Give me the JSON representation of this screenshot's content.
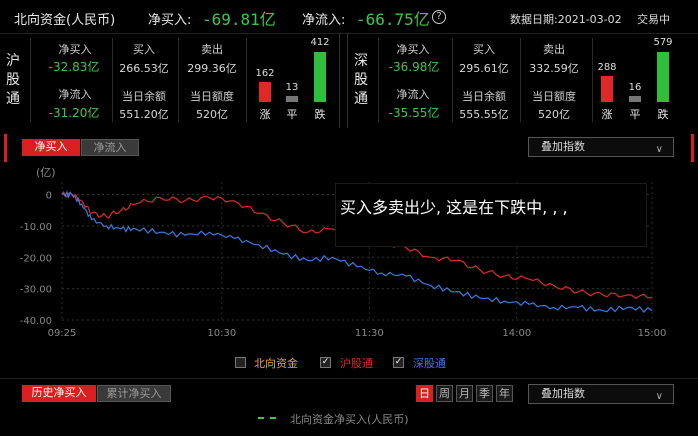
{
  "header": {
    "title": "北向资金(人民币)",
    "net_buy_label": "净买入:",
    "net_buy_value": "-69.81亿",
    "net_inflow_label": "净流入:",
    "net_inflow_value": "-66.75亿",
    "help_icon": "?",
    "date_text": "数据日期:2021-03-02",
    "status": "交易中"
  },
  "sh": {
    "name": "沪股通",
    "net_buy_label": "净买入",
    "net_buy_value": "-32.83亿",
    "net_inflow_label": "净流入",
    "net_inflow_value": "-31.20亿",
    "buy_label": "买入",
    "buy_value": "266.53亿",
    "sell_label": "卖出",
    "sell_value": "299.36亿",
    "balance_label": "当日余额",
    "balance_value": "551.20亿",
    "quota_label": "当日额度",
    "quota_value": "520亿",
    "up": "162",
    "flat": "13",
    "down": "412",
    "up_label": "涨",
    "flat_label": "平",
    "down_label": "跌"
  },
  "sz": {
    "name": "深股通",
    "net_buy_label": "净买入",
    "net_buy_value": "-36.98亿",
    "net_inflow_label": "净流入",
    "net_inflow_value": "-35.55亿",
    "buy_label": "买入",
    "buy_value": "295.61亿",
    "sell_label": "卖出",
    "sell_value": "332.59亿",
    "balance_label": "当日余额",
    "balance_value": "555.55亿",
    "quota_label": "当日额度",
    "quota_value": "520亿",
    "up": "288",
    "flat": "16",
    "down": "579",
    "up_label": "涨",
    "flat_label": "平",
    "down_label": "跌"
  },
  "chart_tabs": {
    "net_buy": "净买入",
    "net_inflow": "净流入"
  },
  "overlay_dropdown": "叠加指数",
  "annotation": "买入多卖出少, 这是在下跌中, , ,",
  "chart_data": {
    "type": "line",
    "ylabel": "(亿)",
    "yticks": [
      "0",
      "-10.00",
      "-20.00",
      "-30.00",
      "-40.00"
    ],
    "xticks": [
      "09:25",
      "10:30",
      "11:30",
      "14:00",
      "15:00"
    ],
    "ylim": [
      -40,
      4
    ],
    "series": [
      {
        "name": "沪股通",
        "color": "#e02828",
        "x": [
          0,
          4,
          8,
          12,
          18,
          24,
          30,
          40,
          50,
          60,
          70,
          80,
          90,
          100,
          110,
          120,
          130,
          140,
          150,
          160,
          170,
          180,
          190,
          200,
          210,
          220,
          230,
          240
        ],
        "values": [
          0,
          0,
          -2,
          -6,
          -7,
          -5,
          -3,
          -1,
          -2,
          -1,
          -2,
          -6,
          -9,
          -12,
          -11,
          -14,
          -15,
          -17,
          -20,
          -21,
          -24,
          -26,
          -27,
          -29,
          -31,
          -32,
          -32,
          -32.8
        ]
      },
      {
        "name": "深股通",
        "color": "#3a7be0",
        "x": [
          0,
          4,
          8,
          12,
          18,
          24,
          30,
          40,
          50,
          60,
          70,
          80,
          90,
          100,
          110,
          120,
          130,
          140,
          150,
          160,
          170,
          180,
          190,
          200,
          210,
          220,
          230,
          240
        ],
        "values": [
          0,
          0,
          -3,
          -8,
          -10,
          -11,
          -11,
          -12,
          -13,
          -12,
          -14,
          -16,
          -19,
          -21,
          -20,
          -23,
          -25,
          -26,
          -29,
          -31,
          -33,
          -34,
          -35,
          -36,
          -36,
          -37,
          -36,
          -37
        ]
      }
    ],
    "legend": [
      {
        "label": "北向资金",
        "checked": false,
        "color": "#e8a23a"
      },
      {
        "label": "沪股通",
        "checked": true,
        "color": "#e02828"
      },
      {
        "label": "深股通",
        "checked": true,
        "color": "#3a7be0"
      }
    ]
  },
  "bottom": {
    "tab_hist": "历史净买入",
    "tab_cum": "累计净买入",
    "periods": [
      "日",
      "周",
      "月",
      "季",
      "年"
    ],
    "overlay_dropdown": "叠加指数",
    "legend_label": "北向资金净买入(人民币)"
  }
}
